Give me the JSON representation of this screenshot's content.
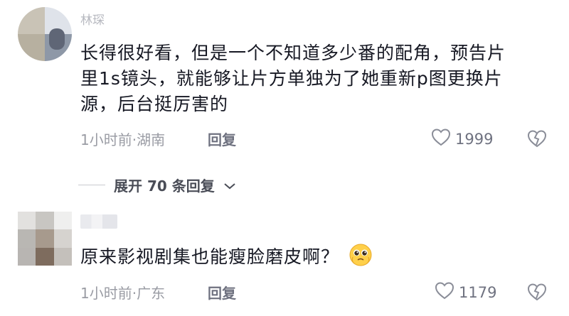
{
  "comments": [
    {
      "username": "林琛",
      "text_line1": "长得很好看，但是一个不知道多少番的配角，预告片",
      "text_line2": "里1s镜头，就能够让片方单独为了她重新p图更换片",
      "text_line3": "源，后台挺厉害的",
      "time_location": "1小时前·湖南",
      "reply_label": "回复",
      "likes": "1999"
    },
    {
      "username": "",
      "text": "原来影视剧集也能瘦脸磨皮啊？",
      "time_location": "1小时前·广东",
      "reply_label": "回复",
      "likes": "1179"
    }
  ],
  "expand_replies": "展开 70 条回复",
  "icons": {
    "like": "heart-outline-icon",
    "dislike": "broken-heart-icon",
    "expand": "chevron-down-icon",
    "emoji": "pleading-face-emoji"
  },
  "colors": {
    "text": "#161823",
    "meta": "#9a9ca4",
    "action": "#6f7280"
  }
}
